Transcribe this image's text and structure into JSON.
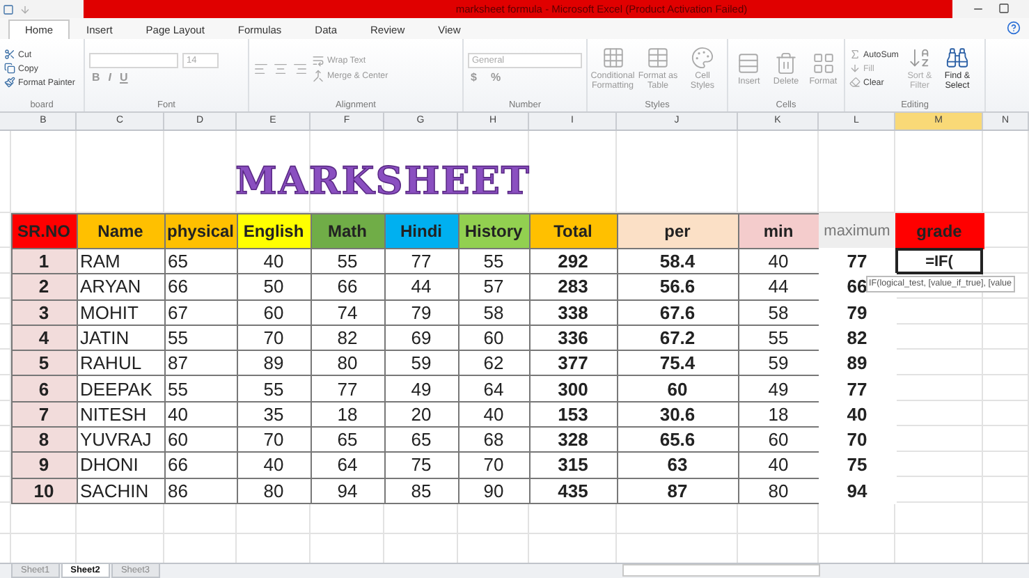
{
  "title_bar": {
    "title": "marksheet formula - Microsoft Excel (Product Activation Failed)"
  },
  "ribbon": {
    "tabs": [
      {
        "label": "Home",
        "selected": true
      },
      {
        "label": "Insert",
        "selected": false
      },
      {
        "label": "Page Layout",
        "selected": false
      },
      {
        "label": "Formulas",
        "selected": false
      },
      {
        "label": "Data",
        "selected": false
      },
      {
        "label": "Review",
        "selected": false
      },
      {
        "label": "View",
        "selected": false
      }
    ],
    "groups": [
      {
        "kind": "clipboard",
        "label": "board",
        "items": [
          "Cut",
          "Copy",
          "Format Painter"
        ]
      },
      {
        "kind": "font",
        "label": "Font",
        "size": "14",
        "buttons": [
          "B",
          "I",
          "U"
        ]
      },
      {
        "kind": "alignment",
        "label": "Alignment",
        "items": [
          "Wrap Text",
          "Merge & Center"
        ]
      },
      {
        "kind": "number",
        "label": "Number",
        "format": "General",
        "items": [
          "$",
          "%"
        ]
      },
      {
        "kind": "styles",
        "label": "Styles",
        "items": [
          "Conditional Formatting",
          "Format as Table",
          "Cell Styles"
        ]
      },
      {
        "kind": "cells",
        "label": "Cells",
        "items": [
          "Insert",
          "Delete",
          "Format"
        ]
      },
      {
        "kind": "editing",
        "label": "Editing",
        "items": [
          "AutoSum",
          "Fill",
          "Clear"
        ],
        "big": [
          "Sort & Filter",
          "Find & Select"
        ]
      }
    ]
  },
  "columns": [
    {
      "label": "B",
      "selected": false
    },
    {
      "label": "C",
      "selected": false
    },
    {
      "label": "D",
      "selected": false
    },
    {
      "label": "E",
      "selected": false
    },
    {
      "label": "F",
      "selected": false
    },
    {
      "label": "G",
      "selected": false
    },
    {
      "label": "H",
      "selected": false
    },
    {
      "label": "I",
      "selected": false
    },
    {
      "label": "J",
      "selected": false
    },
    {
      "label": "K",
      "selected": false
    },
    {
      "label": "L",
      "selected": false
    },
    {
      "label": "M",
      "selected": true
    },
    {
      "label": "N",
      "selected": false
    }
  ],
  "sheet_title": "MARKSHEET",
  "headers": [
    {
      "label": "SR.NO",
      "color": "#ff0000"
    },
    {
      "label": "Name",
      "color": "#ffc000"
    },
    {
      "label": "physical",
      "color": "#ffc000"
    },
    {
      "label": "English",
      "color": "#ffff00"
    },
    {
      "label": "Math",
      "color": "#70ad47"
    },
    {
      "label": "Hindi",
      "color": "#00b0f0"
    },
    {
      "label": "History",
      "color": "#92d050"
    },
    {
      "label": "Total",
      "color": "#ffc000"
    },
    {
      "label": "per",
      "color": "#fbe0c6"
    },
    {
      "label": "min",
      "color": "#f4cccc"
    },
    {
      "label": "maximum",
      "color": "#eeeeee"
    },
    {
      "label": "grade",
      "color": "#ff0000"
    }
  ],
  "rows": [
    [
      "1",
      "RAM",
      "65",
      "40",
      "55",
      "77",
      "55",
      "292",
      "58.4",
      "40",
      "77"
    ],
    [
      "2",
      "ARYAN",
      "66",
      "50",
      "66",
      "44",
      "57",
      "283",
      "56.6",
      "44",
      "66"
    ],
    [
      "3",
      "MOHIT",
      "67",
      "60",
      "74",
      "79",
      "58",
      "338",
      "67.6",
      "58",
      "79"
    ],
    [
      "4",
      "JATIN",
      "55",
      "70",
      "82",
      "69",
      "60",
      "336",
      "67.2",
      "55",
      "82"
    ],
    [
      "5",
      "RAHUL",
      "87",
      "89",
      "80",
      "59",
      "62",
      "377",
      "75.4",
      "59",
      "89"
    ],
    [
      "6",
      "DEEPAK",
      "55",
      "55",
      "77",
      "49",
      "64",
      "300",
      "60",
      "49",
      "77"
    ],
    [
      "7",
      "NITESH",
      "40",
      "35",
      "18",
      "20",
      "40",
      "153",
      "30.6",
      "18",
      "40"
    ],
    [
      "8",
      "YUVRAJ",
      "60",
      "70",
      "65",
      "65",
      "68",
      "328",
      "65.6",
      "60",
      "70"
    ],
    [
      "9",
      "DHONI",
      "66",
      "40",
      "64",
      "75",
      "70",
      "315",
      "63",
      "40",
      "75"
    ],
    [
      "10",
      "SACHIN",
      "86",
      "80",
      "94",
      "85",
      "90",
      "435",
      "87",
      "80",
      "94"
    ]
  ],
  "active_cell": {
    "value": "=IF(",
    "tooltip": "IF(logical_test, [value_if_true], [value"
  },
  "sheet_tabs": [
    {
      "label": "Sheet1",
      "selected": false
    },
    {
      "label": "Sheet2",
      "selected": true
    },
    {
      "label": "Sheet3",
      "selected": false
    }
  ]
}
